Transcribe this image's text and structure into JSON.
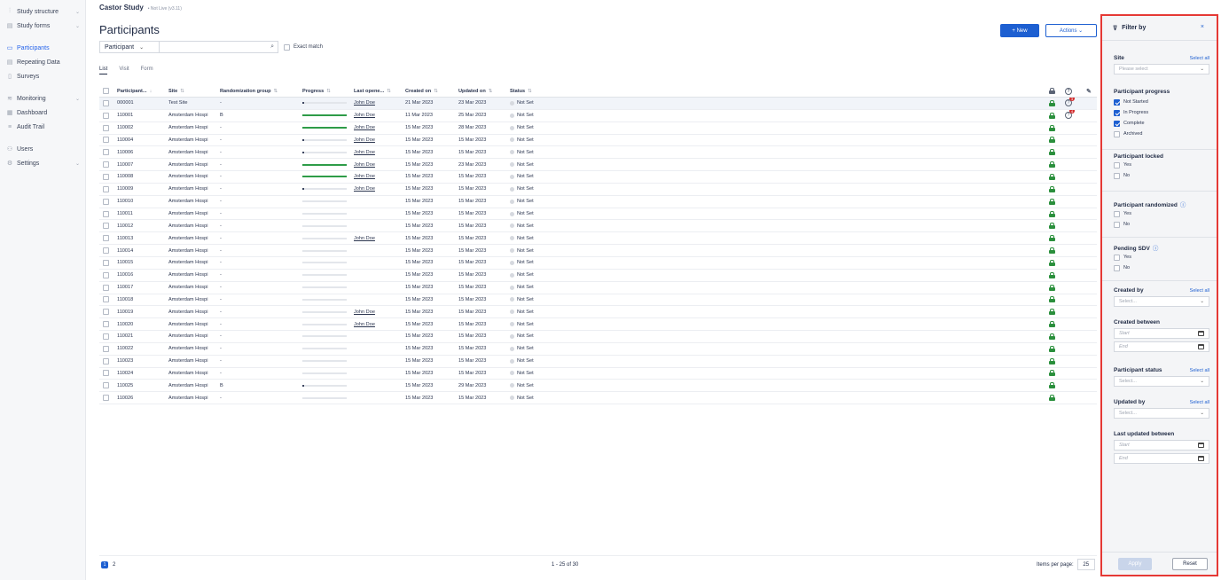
{
  "sidebar": {
    "items": [
      {
        "label": "Study structure",
        "icon": "chart-icon",
        "chev": true
      },
      {
        "label": "Study forms",
        "icon": "form-icon",
        "chev": true
      },
      {
        "gap": true
      },
      {
        "label": "Participants",
        "icon": "folder-icon",
        "active": true
      },
      {
        "label": "Repeating Data",
        "icon": "repeat-icon"
      },
      {
        "label": "Surveys",
        "icon": "survey-icon"
      },
      {
        "gap": true
      },
      {
        "label": "Monitoring",
        "icon": "monitor-icon",
        "chev": true
      },
      {
        "label": "Dashboard",
        "icon": "dashboard-icon"
      },
      {
        "label": "Audit Trail",
        "icon": "audit-icon"
      },
      {
        "gap": true
      },
      {
        "label": "Users",
        "icon": "users-icon"
      },
      {
        "label": "Settings",
        "icon": "gear-icon",
        "chev": true
      }
    ]
  },
  "header": {
    "study_name": "Castor Study",
    "study_status": "• Not Live (v3.11)",
    "page_title": "Participants",
    "new_label": "+ New",
    "actions_label": "Actions ⌄"
  },
  "search": {
    "field_label": "Participant",
    "placeholder": "",
    "exact_match_label": "Exact match"
  },
  "tabs": [
    {
      "label": "List",
      "active": true
    },
    {
      "label": "Visit"
    },
    {
      "label": "Form"
    }
  ],
  "table": {
    "headers": {
      "id": "Participant...",
      "site": "Site",
      "rand": "Randomization group",
      "progress": "Progress",
      "last_opened": "Last opene...",
      "created": "Created on",
      "updated": "Updated on",
      "status": "Status"
    },
    "rows": [
      {
        "id": "000001",
        "site": "Test Site",
        "rand": "-",
        "progress": 0.02,
        "opened": "John Doe",
        "created": "21 Mar 2023",
        "updated": "23 Mar 2023",
        "status": "Not Set",
        "queries": "3",
        "selected": true
      },
      {
        "id": "110001",
        "site": "Amsterdam Hospi",
        "rand": "B",
        "progress": 1.0,
        "opened": "John Doe",
        "created": "11 Mar 2023",
        "updated": "25 Mar 2023",
        "status": "Not Set",
        "queries": "4"
      },
      {
        "id": "110002",
        "site": "Amsterdam Hospi",
        "rand": "-",
        "progress": 1.0,
        "opened": "John Doe",
        "created": "15 Mar 2023",
        "updated": "28 Mar 2023",
        "status": "Not Set"
      },
      {
        "id": "110004",
        "site": "Amsterdam Hospi",
        "rand": "-",
        "progress": 0.02,
        "opened": "John Doe",
        "created": "15 Mar 2023",
        "updated": "15 Mar 2023",
        "status": "Not Set"
      },
      {
        "id": "110006",
        "site": "Amsterdam Hospi",
        "rand": "-",
        "progress": 0.02,
        "opened": "John Doe",
        "created": "15 Mar 2023",
        "updated": "15 Mar 2023",
        "status": "Not Set"
      },
      {
        "id": "110007",
        "site": "Amsterdam Hospi",
        "rand": "-",
        "progress": 1.0,
        "opened": "John Doe",
        "created": "15 Mar 2023",
        "updated": "23 Mar 2023",
        "status": "Not Set"
      },
      {
        "id": "110008",
        "site": "Amsterdam Hospi",
        "rand": "-",
        "progress": 1.0,
        "opened": "John Doe",
        "created": "15 Mar 2023",
        "updated": "15 Mar 2023",
        "status": "Not Set"
      },
      {
        "id": "110009",
        "site": "Amsterdam Hospi",
        "rand": "-",
        "progress": 0.02,
        "opened": "John Doe",
        "created": "15 Mar 2023",
        "updated": "15 Mar 2023",
        "status": "Not Set"
      },
      {
        "id": "110010",
        "site": "Amsterdam Hospi",
        "rand": "-",
        "progress": 0,
        "opened": "",
        "created": "15 Mar 2023",
        "updated": "15 Mar 2023",
        "status": "Not Set"
      },
      {
        "id": "110011",
        "site": "Amsterdam Hospi",
        "rand": "-",
        "progress": 0,
        "opened": "",
        "created": "15 Mar 2023",
        "updated": "15 Mar 2023",
        "status": "Not Set"
      },
      {
        "id": "110012",
        "site": "Amsterdam Hospi",
        "rand": "-",
        "progress": 0,
        "opened": "",
        "created": "15 Mar 2023",
        "updated": "15 Mar 2023",
        "status": "Not Set"
      },
      {
        "id": "110013",
        "site": "Amsterdam Hospi",
        "rand": "-",
        "progress": 0,
        "opened": "John Doe",
        "created": "15 Mar 2023",
        "updated": "15 Mar 2023",
        "status": "Not Set"
      },
      {
        "id": "110014",
        "site": "Amsterdam Hospi",
        "rand": "-",
        "progress": 0,
        "opened": "",
        "created": "15 Mar 2023",
        "updated": "15 Mar 2023",
        "status": "Not Set"
      },
      {
        "id": "110015",
        "site": "Amsterdam Hospi",
        "rand": "-",
        "progress": 0,
        "opened": "",
        "created": "15 Mar 2023",
        "updated": "15 Mar 2023",
        "status": "Not Set"
      },
      {
        "id": "110016",
        "site": "Amsterdam Hospi",
        "rand": "-",
        "progress": 0,
        "opened": "",
        "created": "15 Mar 2023",
        "updated": "15 Mar 2023",
        "status": "Not Set"
      },
      {
        "id": "110017",
        "site": "Amsterdam Hospi",
        "rand": "-",
        "progress": 0,
        "opened": "",
        "created": "15 Mar 2023",
        "updated": "15 Mar 2023",
        "status": "Not Set"
      },
      {
        "id": "110018",
        "site": "Amsterdam Hospi",
        "rand": "-",
        "progress": 0,
        "opened": "",
        "created": "15 Mar 2023",
        "updated": "15 Mar 2023",
        "status": "Not Set"
      },
      {
        "id": "110019",
        "site": "Amsterdam Hospi",
        "rand": "-",
        "progress": 0,
        "opened": "John Doe",
        "created": "15 Mar 2023",
        "updated": "15 Mar 2023",
        "status": "Not Set"
      },
      {
        "id": "110020",
        "site": "Amsterdam Hospi",
        "rand": "-",
        "progress": 0,
        "opened": "John Doe",
        "created": "15 Mar 2023",
        "updated": "15 Mar 2023",
        "status": "Not Set"
      },
      {
        "id": "110021",
        "site": "Amsterdam Hospi",
        "rand": "-",
        "progress": 0,
        "opened": "",
        "created": "15 Mar 2023",
        "updated": "15 Mar 2023",
        "status": "Not Set"
      },
      {
        "id": "110022",
        "site": "Amsterdam Hospi",
        "rand": "-",
        "progress": 0,
        "opened": "",
        "created": "15 Mar 2023",
        "updated": "15 Mar 2023",
        "status": "Not Set"
      },
      {
        "id": "110023",
        "site": "Amsterdam Hospi",
        "rand": "-",
        "progress": 0,
        "opened": "",
        "created": "15 Mar 2023",
        "updated": "15 Mar 2023",
        "status": "Not Set"
      },
      {
        "id": "110024",
        "site": "Amsterdam Hospi",
        "rand": "-",
        "progress": 0,
        "opened": "",
        "created": "15 Mar 2023",
        "updated": "15 Mar 2023",
        "status": "Not Set"
      },
      {
        "id": "110025",
        "site": "Amsterdam Hospi",
        "rand": "B",
        "progress": 0.02,
        "opened": "",
        "created": "15 Mar 2023",
        "updated": "29 Mar 2023",
        "status": "Not Set"
      },
      {
        "id": "110026",
        "site": "Amsterdam Hospi",
        "rand": "-",
        "progress": 0,
        "opened": "",
        "created": "15 Mar 2023",
        "updated": "15 Mar 2023",
        "status": "Not Set"
      }
    ]
  },
  "pagination": {
    "page1": "1",
    "page2": "2",
    "range": "1 - 25 of 30",
    "items_per_page_label": "Items per page:",
    "items_per_page": "25"
  },
  "filter": {
    "title": "Filter by",
    "close": "×",
    "select_all": "Select all",
    "site_title": "Site",
    "site_placeholder": "Please select",
    "progress_title": "Participant progress",
    "progress_options": [
      {
        "label": "Not Started",
        "checked": true
      },
      {
        "label": "In Progress",
        "checked": true
      },
      {
        "label": "Complete",
        "checked": true
      },
      {
        "label": "Archived",
        "checked": false
      }
    ],
    "locked_title": "Participant locked",
    "randomized_title": "Participant randomized",
    "sdv_title": "Pending SDV",
    "yes": "Yes",
    "no": "No",
    "created_by_title": "Created by",
    "select_placeholder": "Select...",
    "created_between_title": "Created between",
    "start": "Start",
    "end": "End",
    "status_title": "Participant status",
    "updated_by_title": "Updated by",
    "last_updated_title": "Last updated between",
    "apply": "Apply",
    "reset": "Reset"
  },
  "colors": {
    "accent": "#1d5fd1",
    "progress": "#2e9c48",
    "highlight_border": "#e53935",
    "lock": "#2a8f3c",
    "badge": "#d32f2f"
  }
}
